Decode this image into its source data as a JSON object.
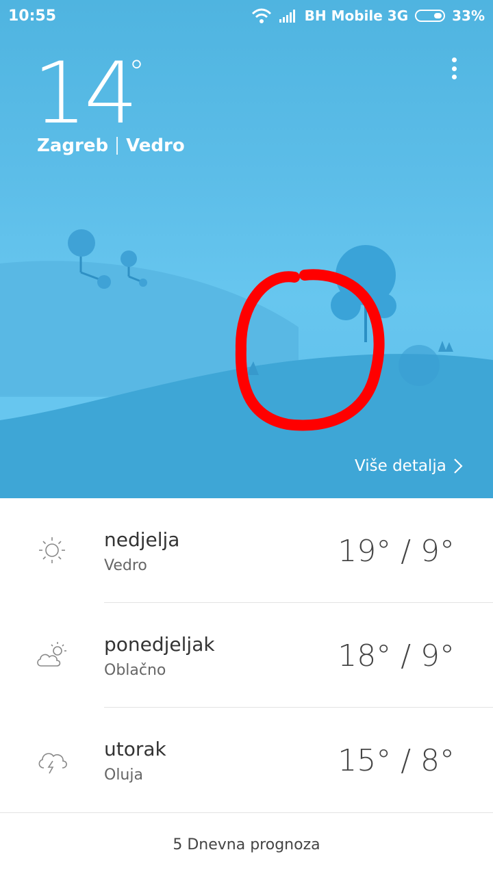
{
  "status_bar": {
    "time": "10:55",
    "carrier": "BH Mobile 3G",
    "battery": "33%",
    "battery_level": 0.33,
    "icons": [
      "wifi-icon",
      "signal-icon",
      "battery-icon"
    ]
  },
  "current": {
    "temperature": "14",
    "degree_symbol": "°",
    "city": "Zagreb",
    "condition": "Vedro"
  },
  "more_details_label": "Više detalja",
  "forecast": [
    {
      "day": "nedjelja",
      "condition": "Vedro",
      "temps": "19° / 9°",
      "icon": "sun-icon"
    },
    {
      "day": "ponedjeljak",
      "condition": "Oblačno",
      "temps": "18° / 9°",
      "icon": "partly-cloudy-icon"
    },
    {
      "day": "utorak",
      "condition": "Oluja",
      "temps": "15° / 8°",
      "icon": "thunderstorm-icon"
    }
  ],
  "footer_label": "5 Dnevna prognoza",
  "colors": {
    "sky_top": "#4fb4e0",
    "sky_mid": "#67c6ef",
    "hill_front": "#3ea6d6",
    "annotation": "#ff0000",
    "text_dark": "#333333"
  }
}
